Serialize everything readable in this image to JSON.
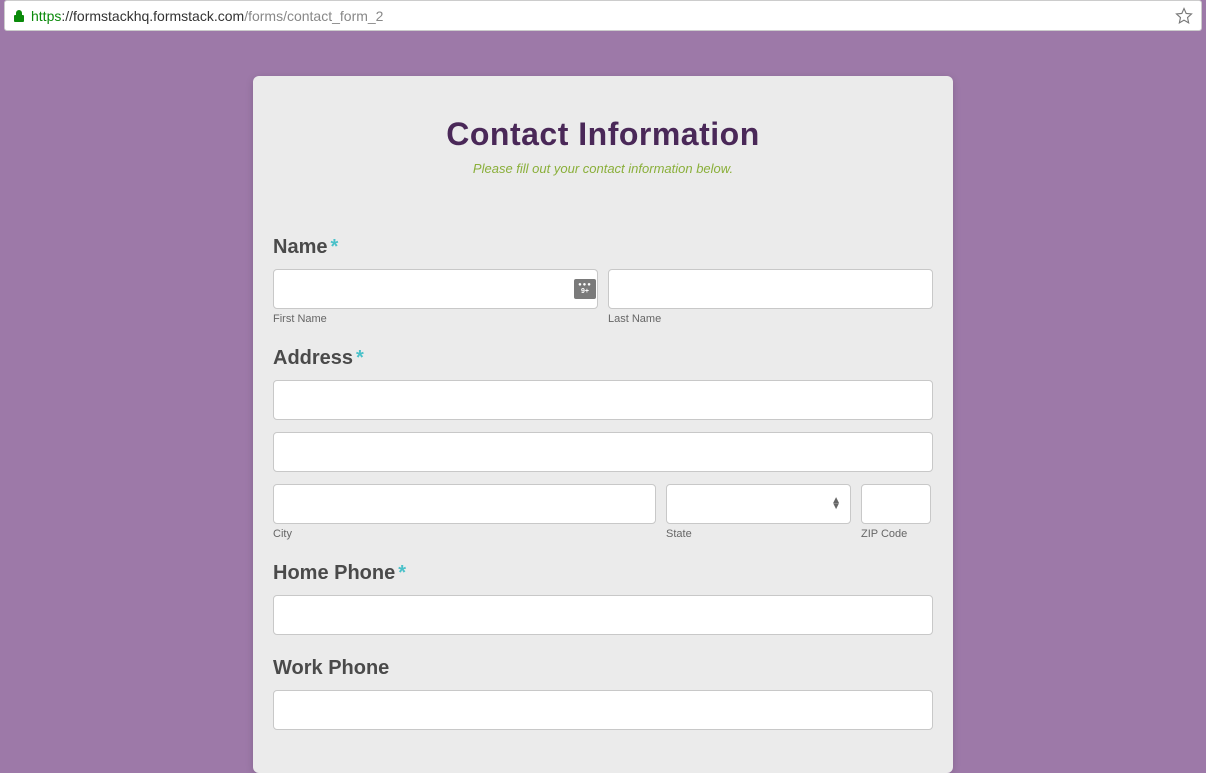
{
  "browser": {
    "url_scheme": "https",
    "url_host": "://formstackhq.formstack.com",
    "url_path": "/forms/contact_form_2"
  },
  "form": {
    "title": "Contact Information",
    "subtitle": "Please fill out your contact information below.",
    "required_mark": "*",
    "fields": {
      "name": {
        "label": "Name",
        "required": true,
        "first_name_sublabel": "First Name",
        "last_name_sublabel": "Last Name"
      },
      "address": {
        "label": "Address",
        "required": true,
        "city_sublabel": "City",
        "state_sublabel": "State",
        "zip_sublabel": "ZIP Code"
      },
      "home_phone": {
        "label": "Home Phone",
        "required": true
      },
      "work_phone": {
        "label": "Work Phone",
        "required": false
      }
    }
  },
  "password_badge": {
    "count": "9+"
  }
}
